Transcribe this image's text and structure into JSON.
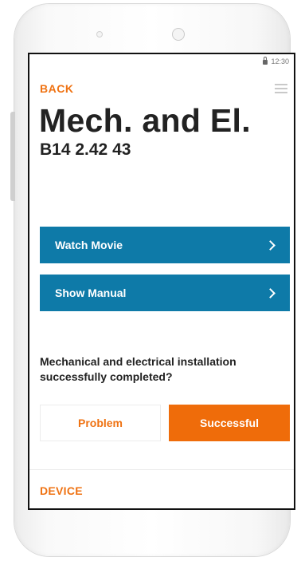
{
  "status_bar": {
    "time": "12:30",
    "lock_icon": "lock-icon"
  },
  "nav": {
    "back_label": "BACK",
    "menu_icon": "hamburger-menu-icon"
  },
  "header": {
    "title": "Mech. and El.",
    "subtitle": "B14 2.42 43"
  },
  "actions": [
    {
      "label": "Watch Movie",
      "icon": "chevron-right-icon"
    },
    {
      "label": "Show Manual",
      "icon": "chevron-right-icon"
    }
  ],
  "question": {
    "text": "Mechanical and electrical installation successfully completed?",
    "problem_label": "Problem",
    "success_label": "Successful"
  },
  "section": {
    "device_label": "DEVICE"
  },
  "colors": {
    "accent": "#ef7212",
    "primary_button": "#0e7aa8",
    "success_button": "#ef6c0a"
  }
}
